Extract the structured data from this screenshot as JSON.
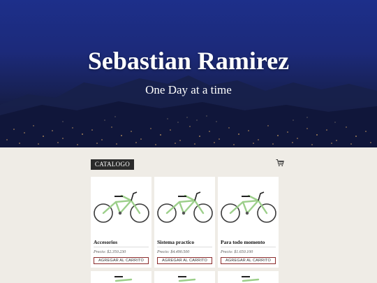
{
  "hero": {
    "title": "Sebastian Ramirez",
    "subtitle": "One Day at a time"
  },
  "catalog": {
    "tab_label": "CATALOGO",
    "cart_icon": "cart-icon"
  },
  "products": [
    {
      "name": "Accesorios",
      "price": "Precio: $2.350.230",
      "button": "AGREGAR AL CARRITO"
    },
    {
      "name": "Sistema practico",
      "price": "Precio: $4.490.500",
      "button": "AGREGAR AL CARRITO"
    },
    {
      "name": "Para todo momento",
      "price": "Precio: $1.650.100",
      "button": "AGREGAR AL CARRITO"
    }
  ],
  "colors": {
    "hero_sky": "#1d2f8a",
    "tab_bg": "#2b2b2b",
    "button_border": "#8b2b2b",
    "page_bg": "#efece6"
  }
}
